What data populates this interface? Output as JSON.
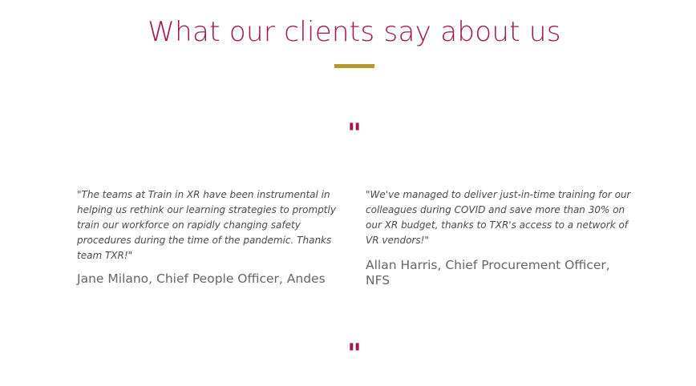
{
  "section": {
    "title": "What our clients say about us",
    "quote_glyph": "\"",
    "accent_color": "#a0174f",
    "underline_color": "#b5972a"
  },
  "testimonials": [
    {
      "quote": "\"The teams at Train in XR have been instrumental in helping us rethink our learning strategies to promptly train our workforce on rapidly changing safety procedures during the time of the pandemic. Thanks team TXR!\"",
      "author": "Jane Milano, Chief People Officer, Andes"
    },
    {
      "quote": "\"We've managed to deliver just-in-time training for our colleagues during COVID and save more than 30% on our XR budget, thanks to TXR's access to a network of VR vendors!\"",
      "author": "Allan Harris, Chief Procurement Officer, NFS"
    }
  ]
}
